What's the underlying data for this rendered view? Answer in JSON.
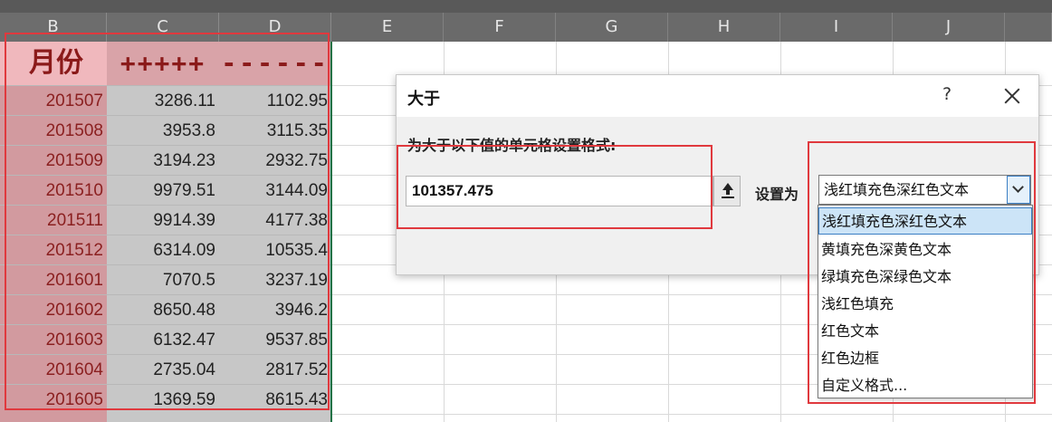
{
  "columns": [
    "B",
    "C",
    "D",
    "E",
    "F",
    "G",
    "H",
    "I",
    "J"
  ],
  "table": {
    "header": {
      "b": "月份",
      "c": "+++++",
      "d": "------"
    },
    "rows": [
      [
        "201507",
        "3286.11",
        "1102.95"
      ],
      [
        "201508",
        "3953.8",
        "3115.35"
      ],
      [
        "201509",
        "3194.23",
        "2932.75"
      ],
      [
        "201510",
        "9979.51",
        "3144.09"
      ],
      [
        "201511",
        "9914.39",
        "4177.38"
      ],
      [
        "201512",
        "6314.09",
        "10535.4"
      ],
      [
        "201601",
        "7070.5",
        "3237.19"
      ],
      [
        "201602",
        "8650.48",
        "3946.2"
      ],
      [
        "201603",
        "6132.47",
        "9537.85"
      ],
      [
        "201604",
        "2735.04",
        "2817.52"
      ],
      [
        "201605",
        "1369.59",
        "8615.43"
      ]
    ]
  },
  "dialog": {
    "title": "大于",
    "help": "?",
    "prompt": "为大于以下值的单元格设置格式:",
    "value": "101357.475",
    "set_label": "设置为",
    "selected_format": "浅红填充色深红色文本",
    "options": [
      "浅红填充色深红色文本",
      "黄填充色深黄色文本",
      "绿填充色深绿色文本",
      "浅红色填充",
      "红色文本",
      "红色边框",
      "自定义格式..."
    ]
  },
  "colors": {
    "accent_red": "#e0393e",
    "selection_blue": "#cce4f7",
    "header_dark_red": "#8b1a1a"
  }
}
